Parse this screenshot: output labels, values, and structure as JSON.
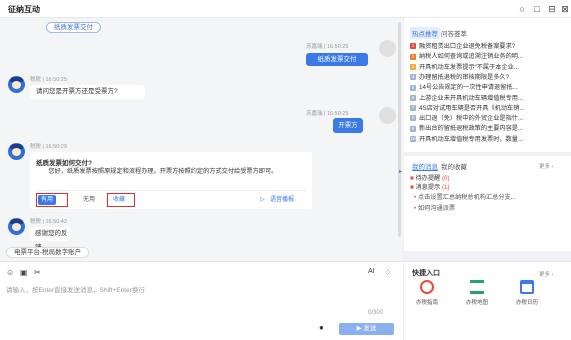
{
  "window": {
    "title": "征纳互动"
  },
  "chat": {
    "pill_top": "纸质发票交付",
    "msg1": {
      "time": "苏嘉瑞 | 16:50:25",
      "text": "纸质发票交付"
    },
    "msg2": {
      "time": "税税 | 16:50:25",
      "text": "请问您是开票方还是受票方?"
    },
    "msg3": {
      "time": "苏嘉瑞 | 16:50:25",
      "text": "开票方"
    },
    "msg4": {
      "time": "税税 | 16:50:29",
      "title": "纸质发票如何交付?",
      "body": "您好，纸质发票按照原规定和流程办理。开票方按照约定的方式交付给受票方即可。",
      "useful": "有用",
      "useless": "无用",
      "collect": "收藏",
      "voice": "语音播报"
    },
    "msg5": {
      "time": "税税 | 16:50:42",
      "text": "感谢您的反馈"
    },
    "platform_pill": "电票平台-税局数字账户"
  },
  "input": {
    "ai_label": "AI",
    "placeholder": "请输入，按Enter直接发送消息，Shift+Enter换行",
    "count": "0/300",
    "send": "▶ 发送"
  },
  "hot": {
    "tab_active": "热点推荐",
    "tab_other": "问答荟萃",
    "items": [
      {
        "n": "1",
        "color": "#e84a3c",
        "text": "融资租赁出口企业退免税备案要求?"
      },
      {
        "n": "2",
        "color": "#f07c2a",
        "text": "纳税人如何查询或追溯注销业务的明..."
      },
      {
        "n": "3",
        "color": "#f2a93b",
        "text": "开具机动车发票提示“不属于本企业..."
      },
      {
        "n": "4",
        "color": "#9fb5cc",
        "text": "办理留抵退税的审核期限是多久?"
      },
      {
        "n": "5",
        "color": "#9fb5cc",
        "text": "14号公告规定的一次性申请退留抵..."
      },
      {
        "n": "6",
        "color": "#9fb5cc",
        "text": "上游企业未开具机动车辆增值税专用..."
      },
      {
        "n": "7",
        "color": "#9fb5cc",
        "text": "4S店对试用车辆是否开具《机动车销..."
      },
      {
        "n": "8",
        "color": "#9fb5cc",
        "text": "出口退（免）税中的外贸企业是指什..."
      },
      {
        "n": "9",
        "color": "#9fb5cc",
        "text": "新出台的留抵退税政策的主要内容是..."
      },
      {
        "n": "10",
        "color": "#9fb5cc",
        "text": "开具机动车增值税专用发票时，数量..."
      }
    ]
  },
  "messages": {
    "tab_active": "我的消息",
    "tab_other": "我的收藏",
    "more": "更多 ›",
    "todo_label": "待办提醒",
    "todo_count": "(0)",
    "notice_label": "消息提示",
    "notice_count": "(1)",
    "items": [
      "点击设置汇总纳税总机构汇总分支...",
      "如何沟通派票"
    ]
  },
  "quick": {
    "title": "快捷入口",
    "more": "更多 ›",
    "items": [
      "办税指南",
      "办税地图",
      "办税日历"
    ]
  }
}
